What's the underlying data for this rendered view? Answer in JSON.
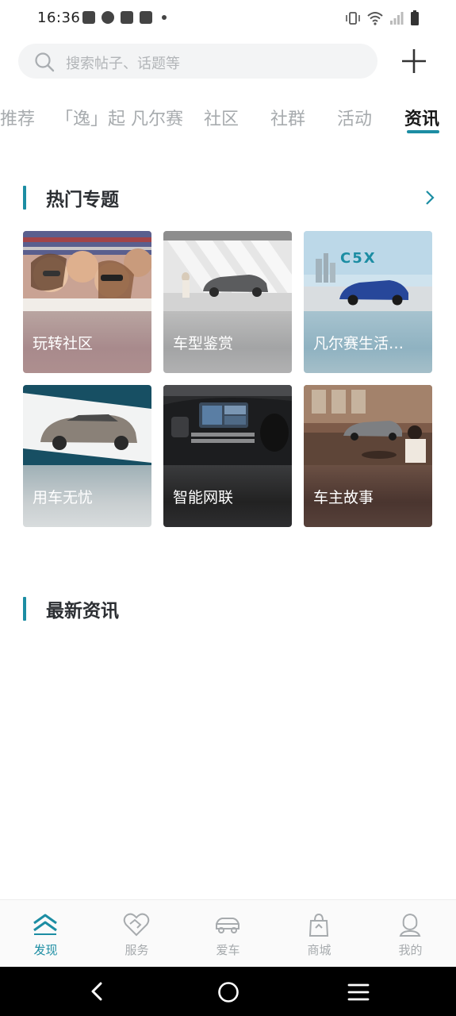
{
  "status_bar": {
    "time": "16:36"
  },
  "search": {
    "placeholder": "搜索帖子、话题等"
  },
  "tabs": [
    {
      "label": "推荐"
    },
    {
      "label": "「逸」起 凡尔赛"
    },
    {
      "label": "社区"
    },
    {
      "label": "社群"
    },
    {
      "label": "活动"
    },
    {
      "label": "资讯",
      "active": true
    }
  ],
  "hot_topics": {
    "title": "热门专题",
    "cards": [
      {
        "label": "玩转社区"
      },
      {
        "label": "车型鉴赏"
      },
      {
        "label": "凡尔赛生活…"
      },
      {
        "label": "用车无忧"
      },
      {
        "label": "智能网联"
      },
      {
        "label": "车主故事"
      }
    ]
  },
  "latest_news": {
    "title": "最新资讯"
  },
  "bottom_nav": [
    {
      "label": "发现",
      "icon": "discover-chevrons-icon",
      "active": true
    },
    {
      "label": "服务",
      "icon": "handshake-heart-icon"
    },
    {
      "label": "爱车",
      "icon": "car-icon"
    },
    {
      "label": "商城",
      "icon": "shopping-bag-icon"
    },
    {
      "label": "我的",
      "icon": "profile-icon"
    }
  ],
  "colors": {
    "accent": "#1c8da3",
    "inactive": "#a7abae",
    "title": "#2c2f33"
  }
}
